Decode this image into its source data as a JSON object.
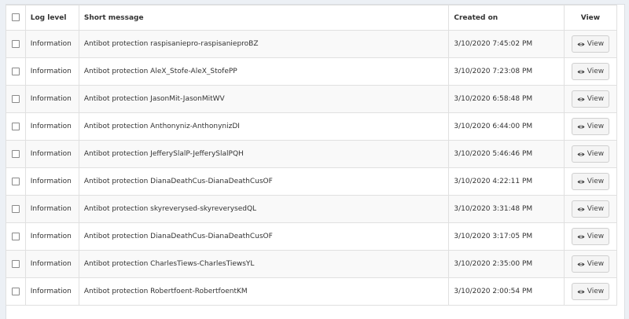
{
  "table": {
    "headers": {
      "log_level": "Log level",
      "short_message": "Short message",
      "created_on": "Created on",
      "view": "View"
    },
    "rows": [
      {
        "log_level": "Information",
        "short_message": "Antibot protection raspisaniepro-raspisanieproBZ",
        "created_on": "3/10/2020 7:45:02 PM",
        "view_label": "View"
      },
      {
        "log_level": "Information",
        "short_message": "Antibot protection AleX_Stofe-AleX_StofePP",
        "created_on": "3/10/2020 7:23:08 PM",
        "view_label": "View"
      },
      {
        "log_level": "Information",
        "short_message": "Antibot protection JasonMit-JasonMitWV",
        "created_on": "3/10/2020 6:58:48 PM",
        "view_label": "View"
      },
      {
        "log_level": "Information",
        "short_message": "Antibot protection Anthonyniz-AnthonynizDI",
        "created_on": "3/10/2020 6:44:00 PM",
        "view_label": "View"
      },
      {
        "log_level": "Information",
        "short_message": "Antibot protection JefferySlalP-JefferySlalPQH",
        "created_on": "3/10/2020 5:46:46 PM",
        "view_label": "View"
      },
      {
        "log_level": "Information",
        "short_message": "Antibot protection DianaDeathCus-DianaDeathCusOF",
        "created_on": "3/10/2020 4:22:11 PM",
        "view_label": "View"
      },
      {
        "log_level": "Information",
        "short_message": "Antibot protection skyreverysed-skyreverysedQL",
        "created_on": "3/10/2020 3:31:48 PM",
        "view_label": "View"
      },
      {
        "log_level": "Information",
        "short_message": "Antibot protection DianaDeathCus-DianaDeathCusOF",
        "created_on": "3/10/2020 3:17:05 PM",
        "view_label": "View"
      },
      {
        "log_level": "Information",
        "short_message": "Antibot protection CharlesTiews-CharlesTiewsYL",
        "created_on": "3/10/2020 2:35:00 PM",
        "view_label": "View"
      },
      {
        "log_level": "Information",
        "short_message": "Antibot protection Robertfoent-RobertfoentKM",
        "created_on": "3/10/2020 2:00:54 PM",
        "view_label": "View"
      }
    ]
  },
  "icons": {
    "view": "eye-icon"
  }
}
